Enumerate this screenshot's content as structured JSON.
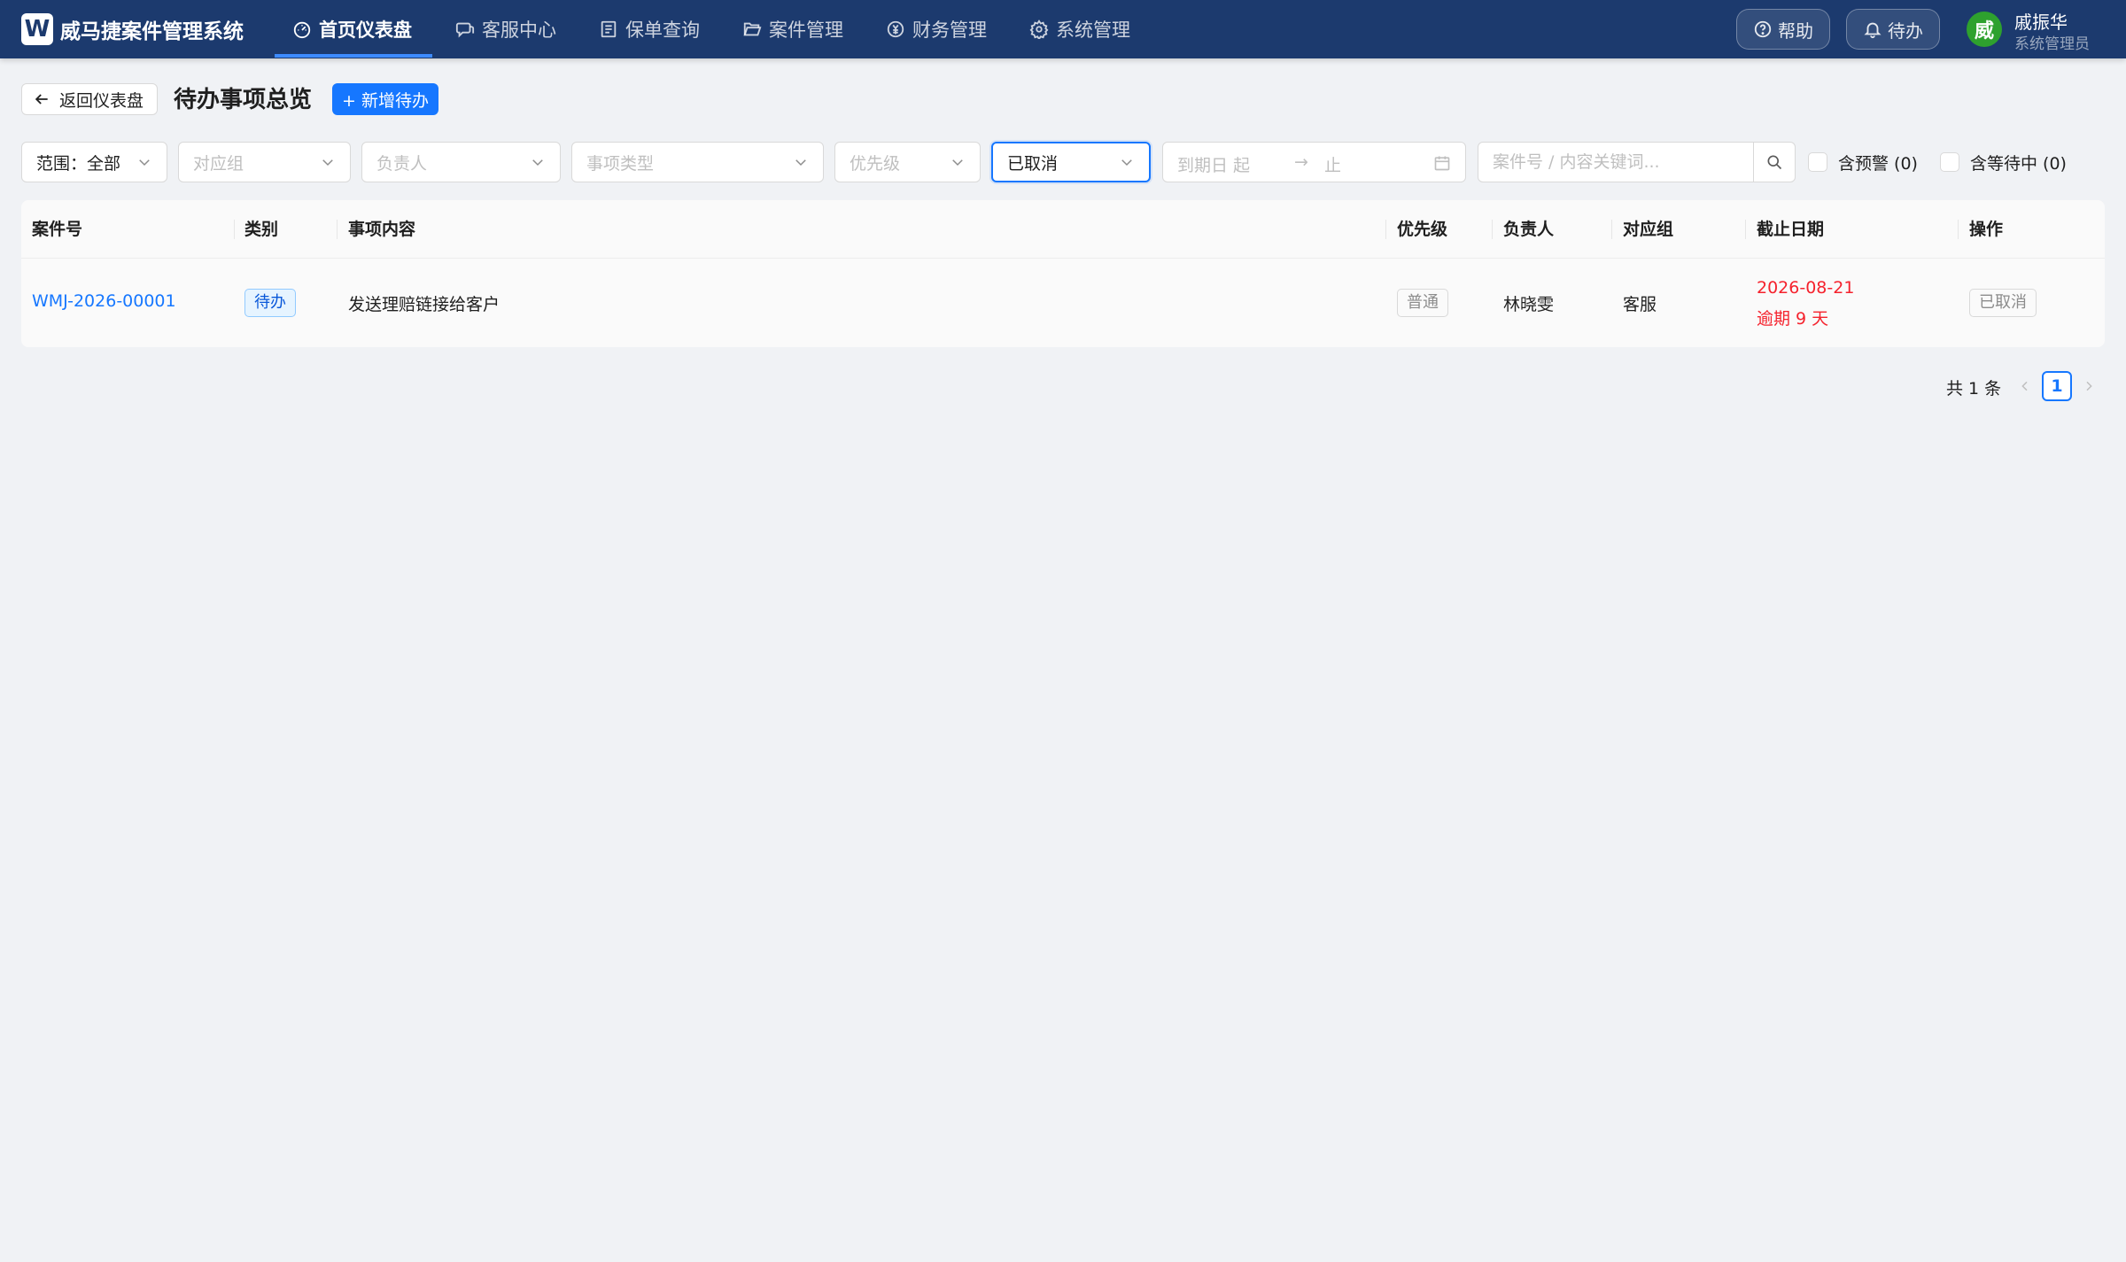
{
  "app": {
    "logo_letter": "W",
    "name": "威马捷案件管理系统"
  },
  "nav": {
    "items": [
      {
        "label": "首页仪表盘",
        "icon": "dashboard-icon",
        "active": true
      },
      {
        "label": "客服中心",
        "icon": "chat-icon",
        "active": false
      },
      {
        "label": "保单查询",
        "icon": "document-list-icon",
        "active": false
      },
      {
        "label": "案件管理",
        "icon": "folder-open-icon",
        "active": false
      },
      {
        "label": "财务管理",
        "icon": "currency-icon",
        "active": false
      },
      {
        "label": "系统管理",
        "icon": "gear-icon",
        "active": false
      }
    ],
    "help_label": "帮助",
    "todo_label": "待办"
  },
  "user": {
    "avatar_text": "威",
    "name": "戚振华",
    "role": "系统管理员",
    "avatar_color": "#2ea12e"
  },
  "header": {
    "back_label": "返回仪表盘",
    "title": "待办事项总览",
    "add_label": "+ 新增待办"
  },
  "filters": {
    "scope": "范围：全部",
    "group_placeholder": "对应组",
    "assignee_placeholder": "负责人",
    "type_placeholder": "事项类型",
    "priority_placeholder": "优先级",
    "status_value": "已取消",
    "date_start_placeholder": "到期日 起",
    "date_arrow": "→",
    "date_end_placeholder": "止",
    "search_placeholder": "案件号 / 内容关键词...",
    "warning_checkbox": "含预警 (0)",
    "waiting_checkbox": "含等待中 (0)"
  },
  "table": {
    "columns": [
      "案件号",
      "类别",
      "事项内容",
      "优先级",
      "负责人",
      "对应组",
      "截止日期",
      "操作"
    ],
    "rows": [
      {
        "case_no": "WMJ-2026-00001",
        "category": "待办",
        "content": "发送理赔链接给客户",
        "priority": "普通",
        "assignee": "林晓雯",
        "group": "客服",
        "due_date": "2026-08-21",
        "overdue": "逾期 9 天",
        "action": "已取消"
      }
    ]
  },
  "pagination": {
    "total": "共 1 条",
    "current_page": "1"
  },
  "colors": {
    "nav_bg": "#1c3a6e",
    "primary": "#1677ff",
    "overdue": "#f5222d"
  }
}
